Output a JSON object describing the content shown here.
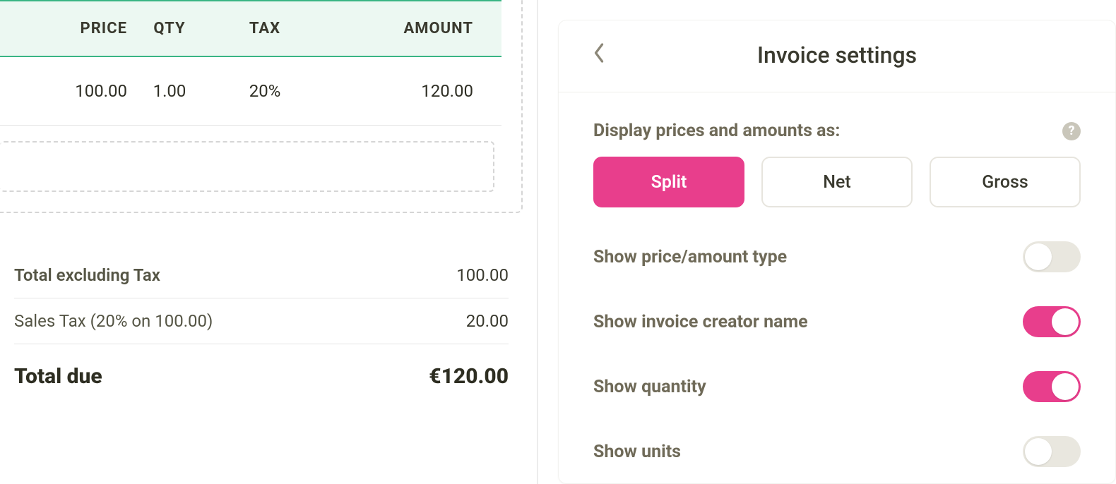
{
  "invoice": {
    "columns": {
      "price": "PRICE",
      "qty": "QTY",
      "tax": "TAX",
      "amount": "AMOUNT"
    },
    "row": {
      "price": "100.00",
      "qty": "1.00",
      "tax": "20%",
      "amount": "120.00"
    },
    "totals": {
      "ex_tax_label": "Total excluding Tax",
      "ex_tax_value": "100.00",
      "tax_label": "Sales Tax (20% on 100.00)",
      "tax_value": "20.00",
      "due_label": "Total due",
      "due_value": "€120.00"
    }
  },
  "settings": {
    "title": "Invoice settings",
    "display_label": "Display prices and amounts as:",
    "help_glyph": "?",
    "segments": {
      "split": "Split",
      "net": "Net",
      "gross": "Gross"
    },
    "toggles": {
      "price_type": "Show price/amount type",
      "creator": "Show invoice creator name",
      "quantity": "Show quantity",
      "units": "Show units"
    }
  }
}
